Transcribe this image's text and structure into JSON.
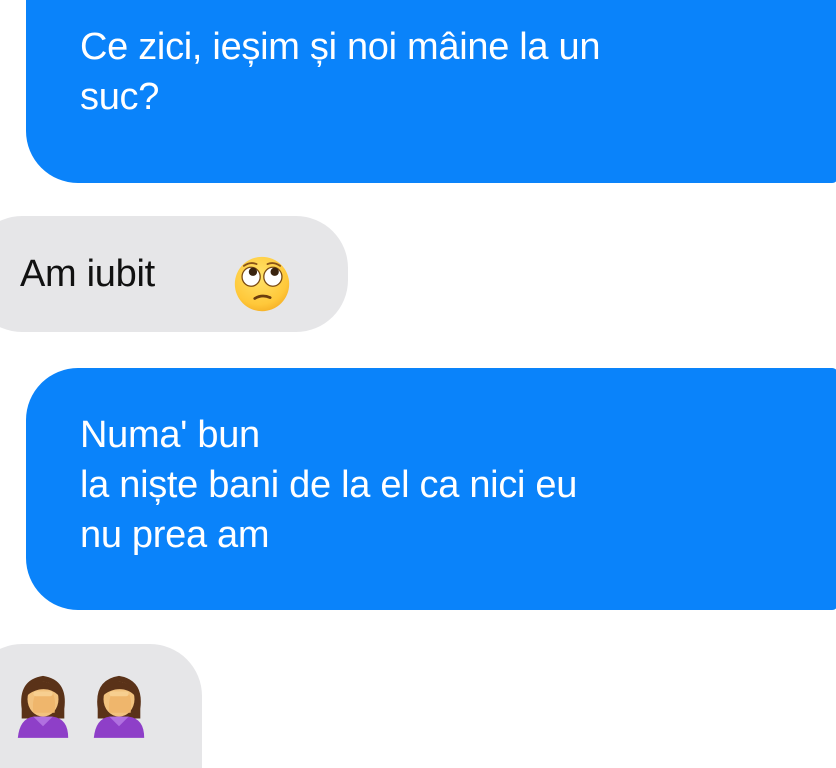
{
  "messages": [
    {
      "direction": "outgoing",
      "lines": [
        "Ce zici, ieșim și noi mâine la un",
        "suc?"
      ]
    },
    {
      "direction": "incoming",
      "text": "Am iubit",
      "emoji": "face-with-rolling-eyes-icon"
    },
    {
      "direction": "outgoing",
      "lines": [
        "Numa' bun",
        "la niște bani de la el ca nici eu",
        "nu prea am"
      ]
    },
    {
      "direction": "incoming",
      "emoji": [
        "woman-facepalming-icon",
        "woman-facepalming-icon"
      ]
    }
  ],
  "colors": {
    "outgoing_bubble": "#0a83fa",
    "outgoing_text": "#ffffff",
    "incoming_bubble": "#e6e6e8",
    "incoming_text": "#111111",
    "background": "#ffffff"
  }
}
